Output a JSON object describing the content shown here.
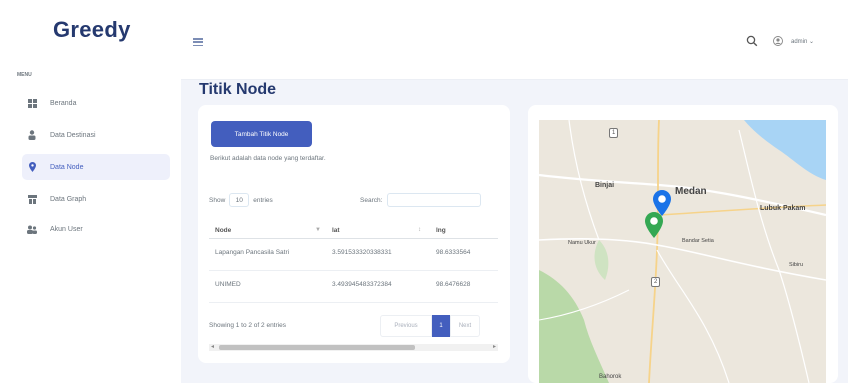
{
  "brand": "Greedy",
  "sidebar": {
    "menu_title": "Menu",
    "items": [
      {
        "label": "Beranda",
        "icon": "grid-icon",
        "active": false
      },
      {
        "label": "Data Destinasi",
        "icon": "person-icon",
        "active": false
      },
      {
        "label": "Data Node",
        "icon": "map-pin-icon",
        "active": true
      },
      {
        "label": "Data Graph",
        "icon": "graph-icon",
        "active": false
      },
      {
        "label": "Akun User",
        "icon": "users-icon",
        "active": false
      }
    ]
  },
  "header": {
    "menu_icon": "hamburger-icon",
    "search_icon": "search-icon",
    "user_icon": "user-icon",
    "user_name": "admin ⌄"
  },
  "page": {
    "title": "Titik Node"
  },
  "card": {
    "add_button": "Tambah Titik Node",
    "intro": "Berikut adalah data node yang terdaftar.",
    "length": {
      "prefix": "Show",
      "value": "10",
      "suffix": "entries"
    },
    "search": {
      "label": "Search:",
      "value": ""
    },
    "table": {
      "headers": [
        "Node",
        "lat",
        "lng"
      ],
      "rows": [
        {
          "node": "Lapangan Pancasila Satri",
          "lat": "3.591533320338331",
          "lng": "98.6333564"
        },
        {
          "node": "UNIMED",
          "lat": "3.493945483372384",
          "lng": "98.6476628"
        }
      ]
    },
    "info": "Showing 1 to 2 of 2 entries",
    "pagination": {
      "prev": "Previous",
      "current": "1",
      "next": "Next"
    }
  },
  "map": {
    "labels": [
      {
        "text": "Binjai",
        "bold": true
      },
      {
        "text": "Medan",
        "bold": true
      },
      {
        "text": "Lubuk Pakam",
        "bold": false
      },
      {
        "text": "Namu Ukur",
        "bold": false
      },
      {
        "text": "Bandar Setia",
        "bold": false
      },
      {
        "text": "Sibiru",
        "bold": false
      },
      {
        "text": "Bahorok",
        "bold": false
      }
    ],
    "road_shields": [
      "1",
      "2"
    ],
    "pins": [
      {
        "icon": "blue-map-pin-icon",
        "color": "#1a73e8"
      },
      {
        "icon": "green-map-pin-icon",
        "color": "#34a853"
      }
    ]
  },
  "colors": {
    "primary": "#435ebe",
    "brand": "#25396f",
    "sea": "#a8d4f5",
    "park": "#b9d9a8"
  }
}
